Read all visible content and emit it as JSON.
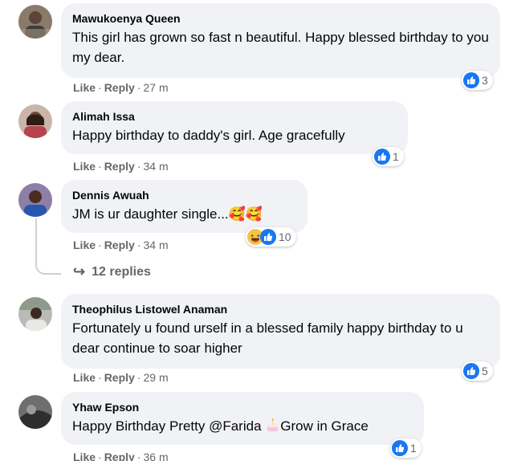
{
  "action_labels": {
    "like": "Like",
    "reply": "Reply",
    "sep": "·"
  },
  "comments": [
    {
      "author": "Mawukoenya Queen",
      "text": "This girl has grown so fast n beautiful. Happy blessed birthday to you my dear.",
      "time": "27 m",
      "reaction_count": "3",
      "reactions": [
        "like-icon"
      ]
    },
    {
      "author": "Alimah Issa",
      "text": "Happy birthday to daddy's girl. Age gracefully",
      "time": "34 m",
      "reaction_count": "1",
      "reactions": [
        "like-icon"
      ]
    },
    {
      "author": "Dennis Awuah",
      "text": "JM is ur daughter single...🥰🥰",
      "time": "34 m",
      "reaction_count": "10",
      "reactions": [
        "haha-icon",
        "like-icon"
      ],
      "replies_label": "12 replies"
    },
    {
      "author": "Theophilus Listowel Anaman",
      "text": "Fortunately u found urself in a blessed family happy birthday to u dear continue to soar higher",
      "time": "29 m",
      "reaction_count": "5",
      "reactions": [
        "like-icon"
      ]
    },
    {
      "author": "Yhaw Epson",
      "text_before": "Happy Birthday Pretty @Farida ",
      "text_after": "Grow in Grace",
      "inline_emoji": "birthday-cake-icon",
      "time": "36 m",
      "reaction_count": "1",
      "reactions": [
        "like-icon"
      ]
    }
  ],
  "colors": {
    "like_blue": "#1877f2",
    "bubble_bg": "#f0f2f5",
    "secondary_text": "#65676b"
  }
}
